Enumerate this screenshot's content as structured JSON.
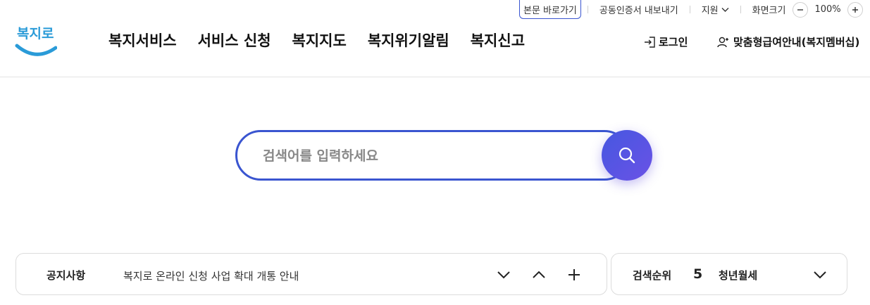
{
  "utility": {
    "skip_link": "본문 바로가기",
    "certificate": "공동인증서 내보내기",
    "support": "지원",
    "font_size_label": "화면크기",
    "zoom_value": "100%"
  },
  "logo": {
    "text": "복지로",
    "brand_color": "#2a9bd8"
  },
  "nav": {
    "items": [
      "복지서비스",
      "서비스 신청",
      "복지지도",
      "복지위기알림",
      "복지신고"
    ]
  },
  "header_actions": {
    "login": "로그인",
    "membership": "맞춤형급여안내(복지멤버십)"
  },
  "search": {
    "placeholder": "검색어를 입력하세요",
    "value": "",
    "accent_color": "#3a55d0"
  },
  "notice": {
    "label": "공지사항",
    "text": "복지로 온라인 신청 사업 확대 개통 안내"
  },
  "ranking": {
    "label": "검색순위",
    "rank": "5",
    "keyword": "청년월세"
  }
}
